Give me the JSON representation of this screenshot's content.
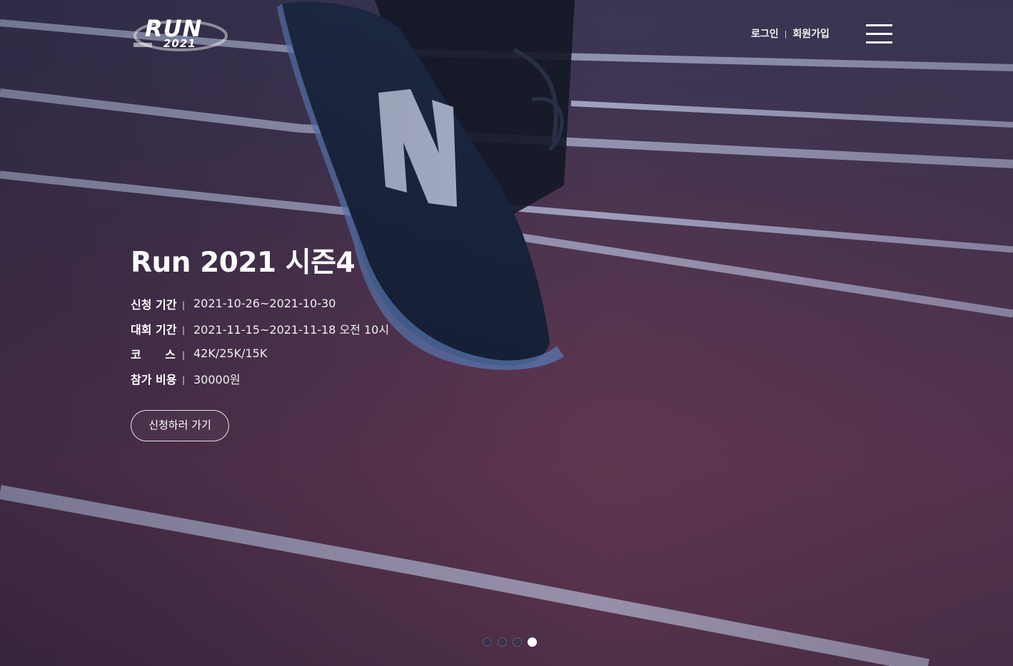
{
  "header": {
    "logo": {
      "main": "RUN",
      "year": "2021"
    },
    "auth": {
      "login": "로그인",
      "separator": "|",
      "signup": "회원가입"
    },
    "menu_icon": "hamburger-menu-icon"
  },
  "hero": {
    "title": "Run 2021 시즌4",
    "info": [
      {
        "label": "신청 기간",
        "separator": "|",
        "value": "2021-10-26~2021-10-30"
      },
      {
        "label": "대회 기간",
        "separator": "|",
        "value": "2021-11-15~2021-11-18 오전 10시"
      },
      {
        "label": "코      스",
        "separator": "|",
        "value": "42K/25K/15K"
      },
      {
        "label": "참가 비용",
        "separator": "|",
        "value": "30000원"
      }
    ],
    "apply_button": "신청하러 가기"
  },
  "pager": {
    "total": 4,
    "active": 4
  },
  "colors": {
    "text": "#ffffff",
    "track": "#5a3552",
    "lane_line": "#cfd6ef"
  }
}
